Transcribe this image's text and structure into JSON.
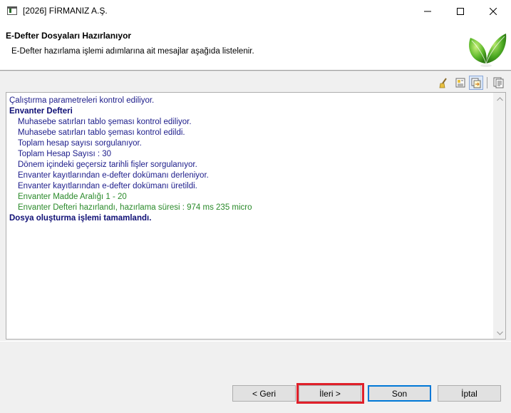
{
  "window": {
    "title": "[2026] FİRMANIZ A.Ş.",
    "minimize_icon": "minimize-icon",
    "maximize_icon": "maximize-icon",
    "close_icon": "close-icon"
  },
  "header": {
    "title": "E-Defter Dosyaları Hazırlanıyor",
    "description": "E-Defter hazırlama işlemi adımlarına ait mesajlar aşağıda listelenir.",
    "logo": "green-leaf-logo"
  },
  "toolbar": {
    "icons": [
      "broom-icon",
      "export-icon",
      "copy-icon",
      "document-icon"
    ]
  },
  "log": {
    "lines": [
      {
        "text": "Çalıştırma parametreleri kontrol ediliyor."
      },
      {
        "text": "Envanter Defteri"
      },
      {
        "text": "Muhasebe satırları tablo şeması kontrol ediliyor."
      },
      {
        "text": "Muhasebe satırları tablo şeması kontrol edildi."
      },
      {
        "text": "Toplam hesap sayısı sorgulanıyor."
      },
      {
        "text": "Toplam Hesap Sayısı : 30"
      },
      {
        "text": "Dönem içindeki geçersiz tarihli fişler sorgulanıyor."
      },
      {
        "text": "Envanter kayıtlarından e-defter dokümanı derleniyor."
      },
      {
        "text": "Envanter kayıtlarından e-defter dokümanı üretildi."
      },
      {
        "text": "Envanter Madde Aralığı 1 - 20"
      },
      {
        "text": "Envanter Defteri hazırlandı, hazırlama süresi : 974 ms 235 micro"
      },
      {
        "text": "Dosya oluşturma işlemi tamamlandı."
      }
    ]
  },
  "buttons": {
    "back": "< Geri",
    "next": "İleri >",
    "finish": "Son",
    "cancel": "İptal"
  },
  "colors": {
    "log_text": "#1c1c8a",
    "log_success": "#2a8a2a",
    "highlight": "#e0202a",
    "default_button_border": "#0078d7"
  }
}
